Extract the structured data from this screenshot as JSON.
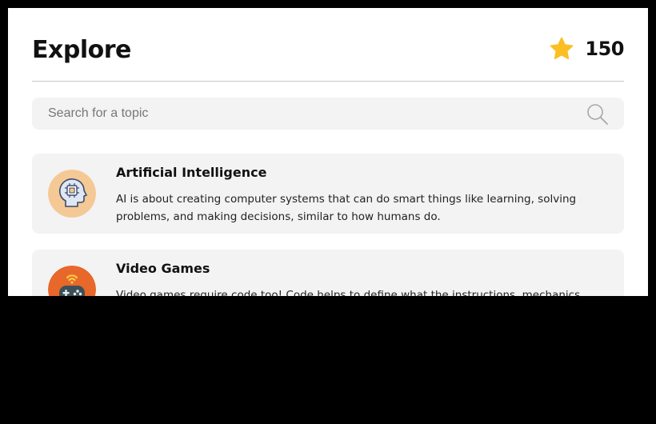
{
  "header": {
    "title": "Explore",
    "points": "150",
    "points_icon": "star-icon",
    "star_color": "#fbbf24"
  },
  "search": {
    "placeholder": "Search for a topic",
    "value": "",
    "icon": "search-icon"
  },
  "topics": [
    {
      "title": "Artificial Intelligence",
      "description": "AI is about creating computer systems that can do smart things like learning, solving problems, and making decisions, similar to how humans do.",
      "icon": "ai-brain-icon",
      "icon_bg": "#f5c995"
    },
    {
      "title": "Video Games",
      "description": "Video games require code too! Code helps to define what the instructions, mechanics",
      "icon": "game-controller-icon",
      "icon_bg": "#e8672a"
    }
  ]
}
